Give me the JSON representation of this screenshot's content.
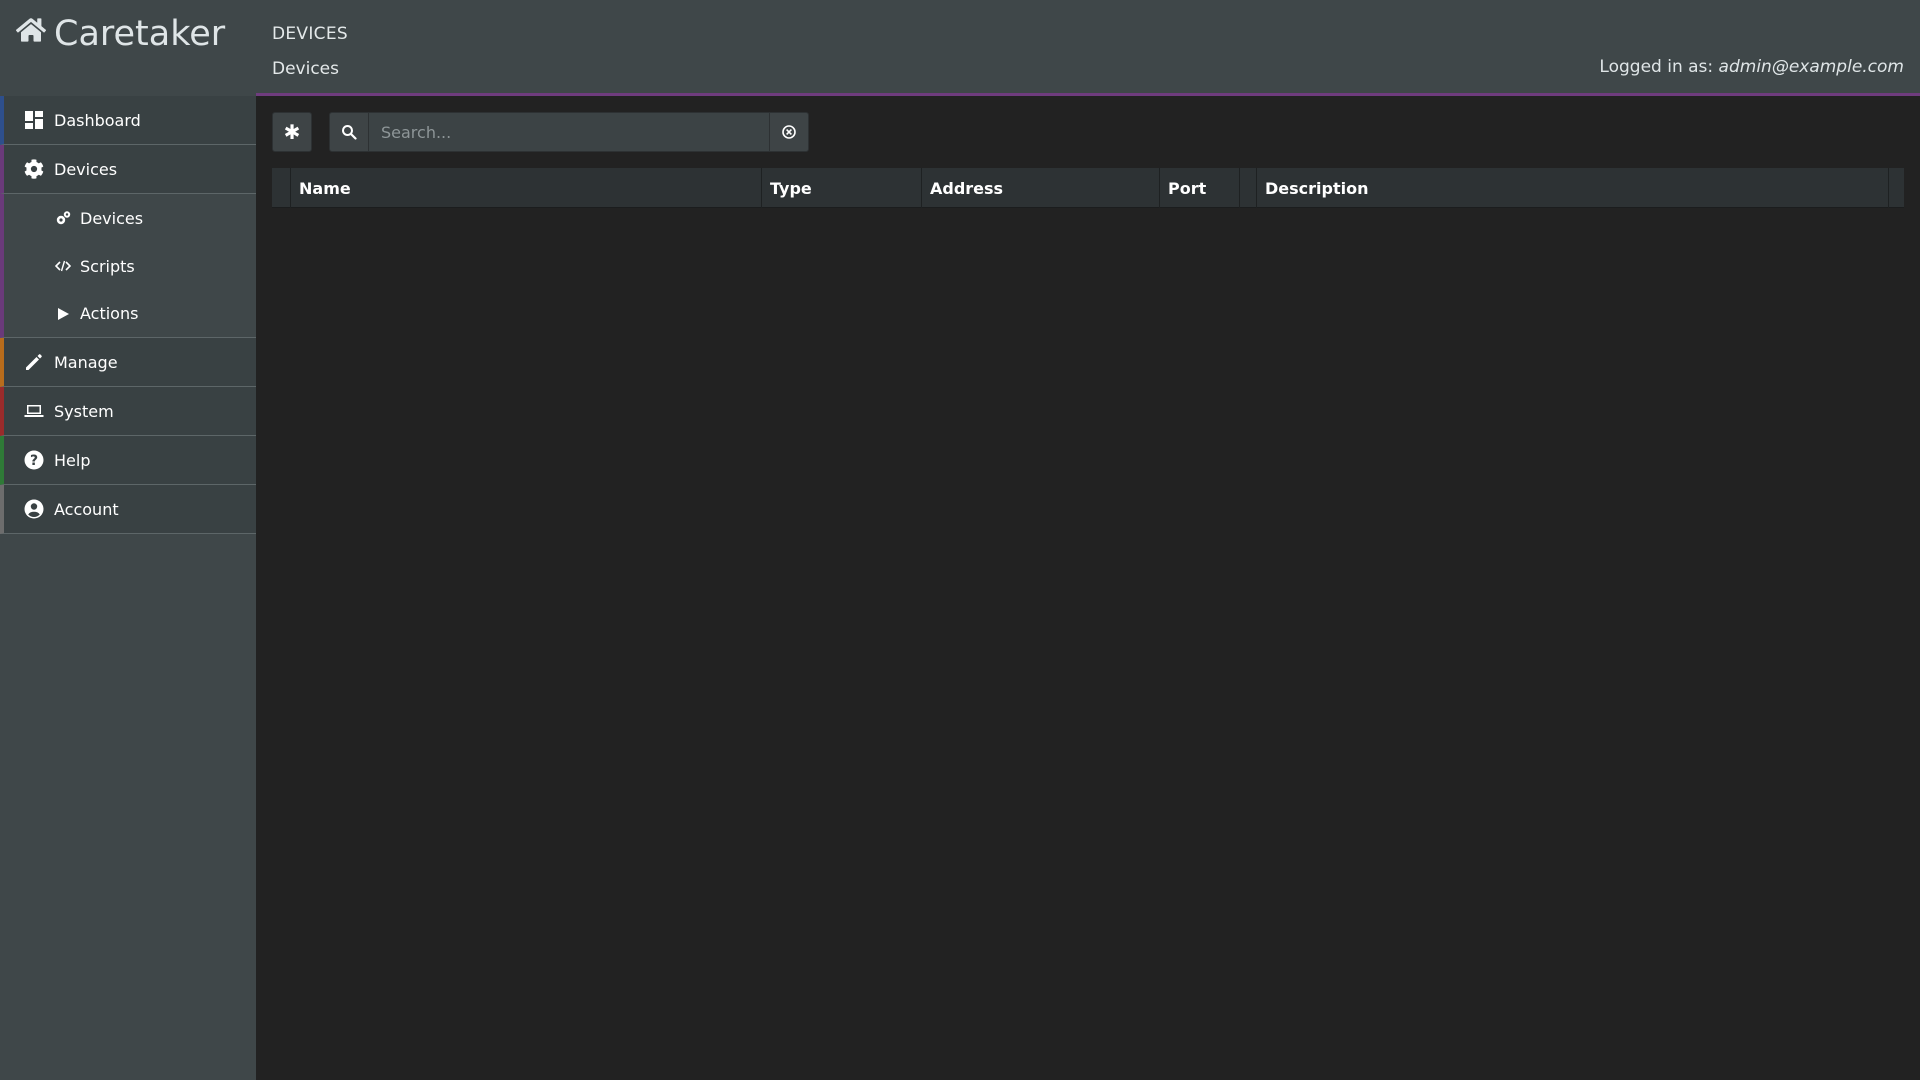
{
  "app": {
    "name": "Caretaker"
  },
  "header": {
    "section_title": "DEVICES",
    "breadcrumb": "Devices",
    "login_label": "Logged in as:",
    "login_user": "admin@example.com"
  },
  "sidebar": {
    "items": [
      {
        "label": "Dashboard",
        "icon": "dashboard-icon",
        "color": "#2e4f8c"
      },
      {
        "label": "Devices",
        "icon": "gear-icon",
        "color": "#6a3a7a"
      },
      {
        "label": "Manage",
        "icon": "pencil-icon",
        "color": "#b86c1c"
      },
      {
        "label": "System",
        "icon": "laptop-icon",
        "color": "#9a2b2b"
      },
      {
        "label": "Help",
        "icon": "question-circle-icon",
        "color": "#2f7a37"
      },
      {
        "label": "Account",
        "icon": "user-circle-icon",
        "color": "#6d6d6d"
      }
    ],
    "subitems": [
      {
        "label": "Devices",
        "icon": "gears-icon"
      },
      {
        "label": "Scripts",
        "icon": "code-icon"
      },
      {
        "label": "Actions",
        "icon": "play-icon"
      }
    ]
  },
  "toolbar": {
    "asterisk_label": "✱",
    "search_placeholder": "Search..."
  },
  "table": {
    "columns": [
      "Name",
      "Type",
      "Address",
      "Port",
      "Description"
    ]
  }
}
